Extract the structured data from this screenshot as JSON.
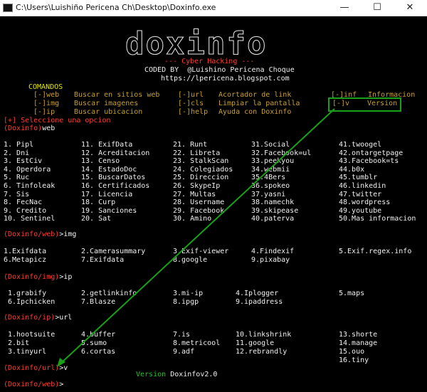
{
  "window": {
    "title": "C:\\Users\\Luishiño Pericena Ch\\Desktop\\Doxinfo.exe",
    "minimize": "—",
    "maximize": "☐",
    "close": "✕"
  },
  "banner": {
    "logo": "doxinfo",
    "subtitle": "--- Cyber Hacking ---",
    "coded_by": "CODED BY  @Luishino Pericena Choque",
    "url": "https://lpericena.blogspot.com"
  },
  "commands": {
    "heading": "COMANDOS",
    "items": [
      {
        "cmd": "[-]web",
        "desc": "Buscar en sitios web"
      },
      {
        "cmd": "[-]img",
        "desc": "Buscar imagenes"
      },
      {
        "cmd": "[-]ip",
        "desc": "Buscar ubicacion"
      },
      {
        "cmd": "[-]url",
        "desc": "Acortador de link"
      },
      {
        "cmd": "[-]cls",
        "desc": "Limpiar la pantalla"
      },
      {
        "cmd": "[-]help",
        "desc": "Ayuda con Doxinfo"
      },
      {
        "cmd": "[-]inf",
        "desc": "Informacion"
      },
      {
        "cmd": "[-]v",
        "desc": "Version"
      }
    ]
  },
  "select_prompt": "[+] Seleccione una opcion",
  "prompts": {
    "p1_app": "(Doxinfo)",
    "p1_cmd": "web",
    "p2_app": "(Doxinfo/web)",
    "p2_cmd": ">img",
    "p3_app": "(Doxinfo/img)",
    "p3_cmd": ">ip",
    "p4_app": "(Doxinfo/ip)",
    "p4_cmd": ">url",
    "p5_app": "(Doxinfo/url)",
    "p5_cmd": ">v",
    "p6_app": "(Doxinfo/web)",
    "p6_cmd": ">"
  },
  "web_list": {
    "col1": [
      "1. Pipl",
      "2. Dni",
      "3. EstCiv",
      "4. Operdora",
      "5. Ruc",
      "6. Tinfoleak",
      "7. Sis",
      "8. FecNac",
      "9. Credito",
      "10. Sentinel"
    ],
    "col2": [
      "11. ExifData",
      "12. Acreditacion",
      "13. Censo",
      "14. EstadoDoc",
      "15. BuscarDatos",
      "16. Certificados",
      "17. Licencia",
      "18. Curp",
      "19. Sanciones",
      "20. Sat"
    ],
    "col3": [
      "21. Runt",
      "22. Libreta",
      "23. StalkScan",
      "24. Colegiados",
      "25. Direccion",
      "26. SkypeIp",
      "27. Multas",
      "28. Username",
      "29. Facebook",
      "30. Amino"
    ],
    "col4": [
      "31.Social",
      "32.Facebook=ul",
      "33.peekyou",
      "34.webmii",
      "35.4Bers",
      "36.spokeo",
      "37.yasni",
      "38.namechk",
      "39.skipease",
      "40.paterva"
    ],
    "col5": [
      "41.twoogel",
      "42.ontargetpage",
      "43.Facebook=ts",
      "44.b0x",
      "45.tumblr",
      "46.linkedin",
      "47.twitter",
      "48.wordpress",
      "49.youtube",
      "50.Mas informacion"
    ]
  },
  "img_list": [
    "1.Exifdata",
    "2.Camerasummary",
    "3.Exif-viewer",
    "4.Findexif",
    "5.Exif.regex.info",
    "6.Metapicz",
    "7.Exifdata",
    "8.google",
    "9.pixabay"
  ],
  "ip_list": [
    "1.grabify",
    "2.getlinkinfo",
    "3.mi-ip",
    "4.Iplogger",
    "5.maps",
    "6.Ipchicken",
    "7.Blasze",
    "8.ipgp",
    "9.ipaddress"
  ],
  "url_list": [
    "1.hootsuite",
    "4.buffer",
    "7.is",
    "10.linkshrink",
    "13.shorte",
    "2.bit",
    "5.sumo",
    "8.metricool",
    "11.google",
    "14.manage",
    "3.tinyurl",
    "6.cortas",
    "9.adf",
    "12.rebrandly",
    "15.ouo",
    "16.tiny"
  ],
  "version_output": {
    "label": "Version",
    "value": "Doxinfov2.0"
  },
  "colors": {
    "prompt_red": "#ff3b30",
    "heading_yellow": "#e6e600",
    "cmd_gold": "#c8a02a",
    "annotation_green": "#18a018"
  }
}
